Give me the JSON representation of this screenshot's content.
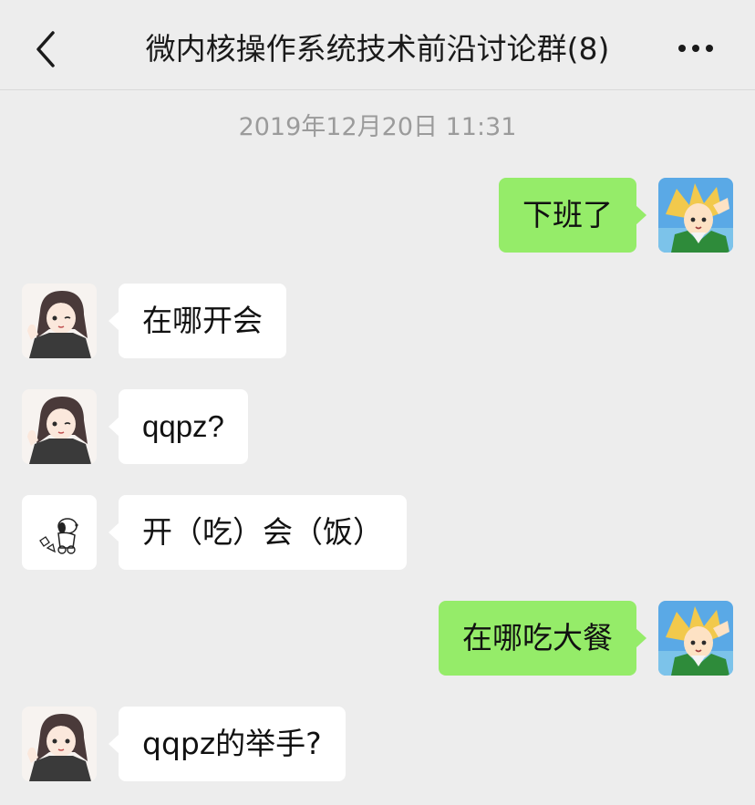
{
  "header": {
    "title": "微内核操作系统技术前沿讨论群(8)",
    "back_icon": "chevron-left-icon",
    "more_icon": "more-horizontal-icon"
  },
  "timestamp": "2019年12月20日 11:31",
  "colors": {
    "background": "#ededed",
    "outgoing_bubble": "#95ec69",
    "incoming_bubble": "#ffffff",
    "timestamp_text": "#9b9b9b"
  },
  "messages": [
    {
      "direction": "out",
      "avatar": "anime-boy-avatar",
      "text": "下班了"
    },
    {
      "direction": "in",
      "avatar": "anime-girl-avatar",
      "text": "在哪开会"
    },
    {
      "direction": "in",
      "avatar": "anime-girl-avatar",
      "text": "qqpz?"
    },
    {
      "direction": "in",
      "avatar": "snoopy-avatar",
      "text": "开（吃）会（饭）"
    },
    {
      "direction": "out",
      "avatar": "anime-boy-avatar",
      "text": "在哪吃大餐"
    },
    {
      "direction": "in",
      "avatar": "anime-girl-avatar",
      "text": "qqpz的举手?"
    }
  ]
}
